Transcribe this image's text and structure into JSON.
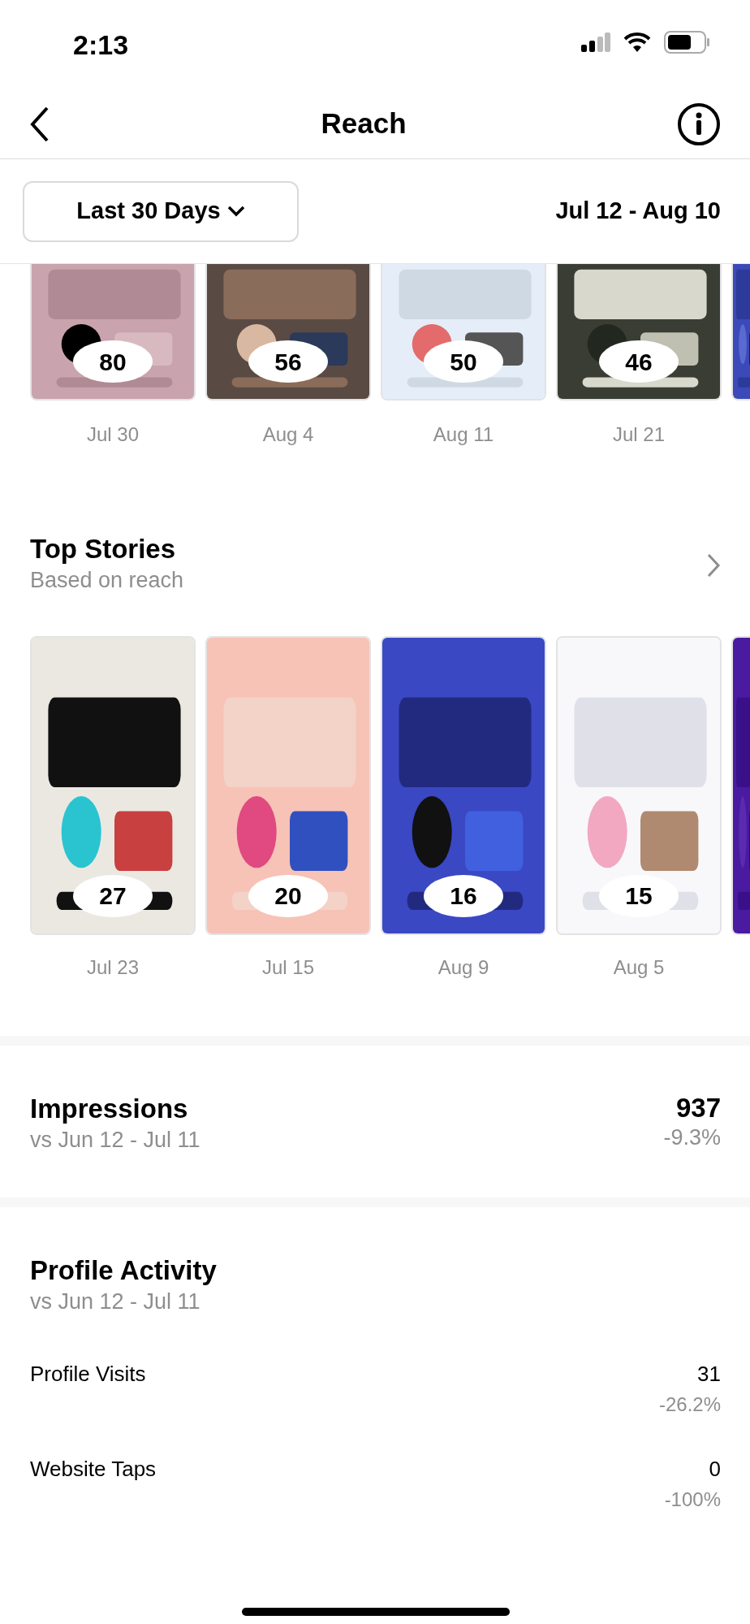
{
  "status_bar": {
    "time": "2:13"
  },
  "header": {
    "title": "Reach"
  },
  "filter": {
    "range": "Last 30 Days",
    "dates": "Jul 12 - Aug 10"
  },
  "top_posts": [
    {
      "count": "80",
      "date": "Jul 30"
    },
    {
      "count": "56",
      "date": "Aug 4"
    },
    {
      "count": "50",
      "date": "Aug 11"
    },
    {
      "count": "46",
      "date": "Jul 21"
    }
  ],
  "top_stories": {
    "title": "Top Stories",
    "subtitle": "Based on reach",
    "items": [
      {
        "count": "27",
        "date": "Jul 23"
      },
      {
        "count": "20",
        "date": "Jul 15"
      },
      {
        "count": "16",
        "date": "Aug 9"
      },
      {
        "count": "15",
        "date": "Aug 5"
      }
    ]
  },
  "impressions": {
    "title": "Impressions",
    "subtitle": "vs Jun 12 - Jul 11",
    "value": "937",
    "change": "-9.3%"
  },
  "profile_activity": {
    "title": "Profile Activity",
    "subtitle": "vs Jun 12 - Jul 11",
    "rows": [
      {
        "label": "Profile Visits",
        "value": "31",
        "change": "-26.2%"
      },
      {
        "label": "Website Taps",
        "value": "0",
        "change": "-100%"
      }
    ]
  }
}
